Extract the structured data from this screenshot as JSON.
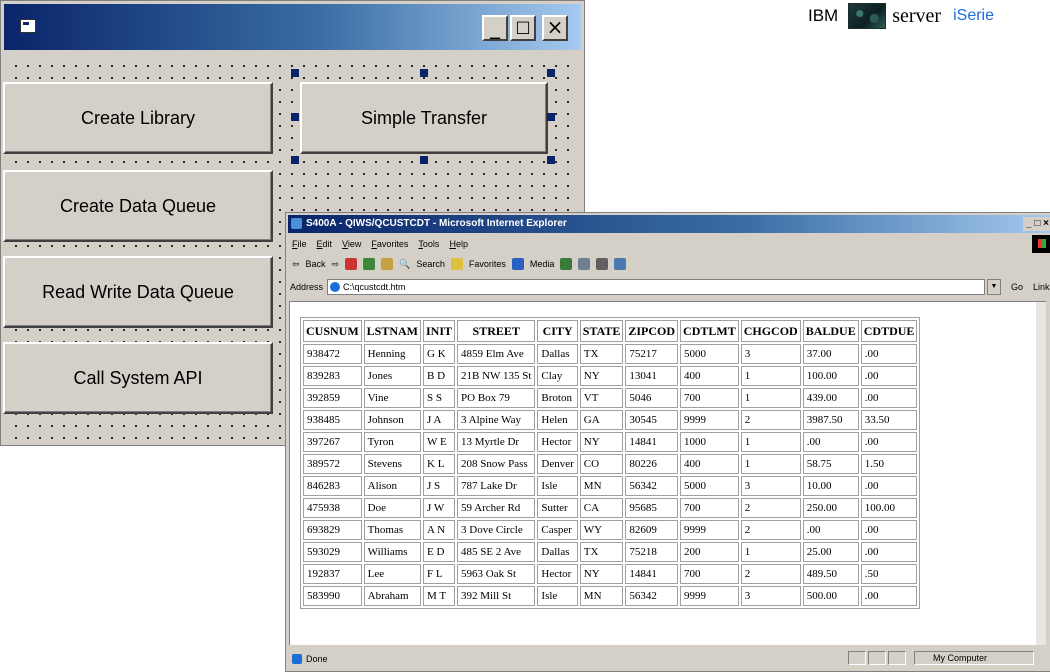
{
  "brand": {
    "ibm": "IBM",
    "server": "server",
    "series": "iSerie"
  },
  "vb_form": {
    "buttons": [
      "Create Library",
      "Simple Transfer",
      "Create Data Queue",
      "Read Write Data Queue",
      "Call System API"
    ],
    "icons": [
      "form-icon",
      "minimize-icon",
      "maximize-icon",
      "close-icon"
    ]
  },
  "ie": {
    "title": "S400A - QIWS/QCUSTCDT - Microsoft Internet Explorer",
    "title_controls": "_ □ ×",
    "menu": [
      "File",
      "Edit",
      "View",
      "Favorites",
      "Tools",
      "Help"
    ],
    "toolbar": {
      "back": "Back",
      "search": "Search",
      "favorites": "Favorites",
      "media": "Media"
    },
    "address_label": "Address",
    "address_value": "C:\\qcustcdt.htm",
    "go_label": "Go",
    "links_label": "Links",
    "status_text": "Done",
    "status_zone": "My Computer"
  },
  "table": {
    "headers": [
      "CUSNUM",
      "LSTNAM",
      "INIT",
      "STREET",
      "CITY",
      "STATE",
      "ZIPCOD",
      "CDTLMT",
      "CHGCOD",
      "BALDUE",
      "CDTDUE"
    ],
    "rows": [
      [
        "938472",
        "Henning",
        "G K",
        "4859 Elm Ave",
        "Dallas",
        "TX",
        "75217",
        "5000",
        "3",
        "37.00",
        ".00"
      ],
      [
        "839283",
        "Jones",
        "B D",
        "21B NW 135 St",
        "Clay",
        "NY",
        "13041",
        "400",
        "1",
        "100.00",
        ".00"
      ],
      [
        "392859",
        "Vine",
        "S S",
        "PO Box 79",
        "Broton",
        "VT",
        "5046",
        "700",
        "1",
        "439.00",
        ".00"
      ],
      [
        "938485",
        "Johnson",
        "J A",
        "3 Alpine Way",
        "Helen",
        "GA",
        "30545",
        "9999",
        "2",
        "3987.50",
        "33.50"
      ],
      [
        "397267",
        "Tyron",
        "W E",
        "13 Myrtle Dr",
        "Hector",
        "NY",
        "14841",
        "1000",
        "1",
        ".00",
        ".00"
      ],
      [
        "389572",
        "Stevens",
        "K L",
        "208 Snow Pass",
        "Denver",
        "CO",
        "80226",
        "400",
        "1",
        "58.75",
        "1.50"
      ],
      [
        "846283",
        "Alison",
        "J S",
        "787 Lake Dr",
        "Isle",
        "MN",
        "56342",
        "5000",
        "3",
        "10.00",
        ".00"
      ],
      [
        "475938",
        "Doe",
        "J W",
        "59 Archer Rd",
        "Sutter",
        "CA",
        "95685",
        "700",
        "2",
        "250.00",
        "100.00"
      ],
      [
        "693829",
        "Thomas",
        "A N",
        "3 Dove Circle",
        "Casper",
        "WY",
        "82609",
        "9999",
        "2",
        ".00",
        ".00"
      ],
      [
        "593029",
        "Williams",
        "E D",
        "485 SE 2 Ave",
        "Dallas",
        "TX",
        "75218",
        "200",
        "1",
        "25.00",
        ".00"
      ],
      [
        "192837",
        "Lee",
        "F L",
        "5963 Oak St",
        "Hector",
        "NY",
        "14841",
        "700",
        "2",
        "489.50",
        ".50"
      ],
      [
        "583990",
        "Abraham",
        "M T",
        "392 Mill St",
        "Isle",
        "MN",
        "56342",
        "9999",
        "3",
        "500.00",
        ".00"
      ]
    ]
  }
}
